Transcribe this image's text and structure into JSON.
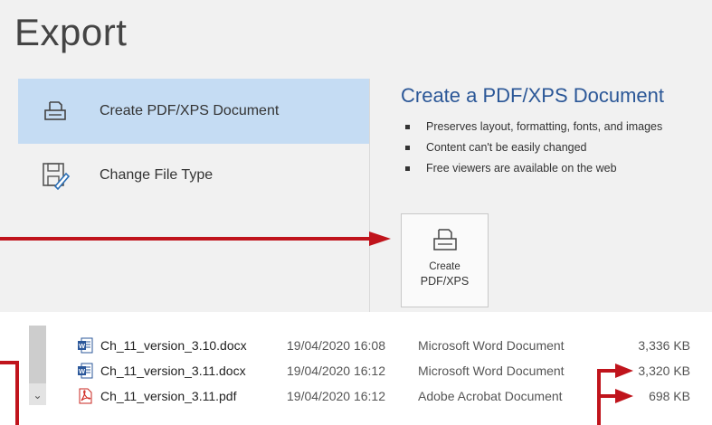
{
  "export_panel": {
    "title": "Export",
    "options": [
      {
        "label": "Create PDF/XPS Document",
        "icon": "printer-document-icon",
        "selected": true
      },
      {
        "label": "Change File Type",
        "icon": "change-file-type-icon",
        "selected": false
      }
    ],
    "pdf_section": {
      "heading": "Create a PDF/XPS Document",
      "bullets": [
        "Preserves layout, formatting, fonts, and images",
        "Content can't be easily changed",
        "Free viewers are available on the web"
      ],
      "button": {
        "line1": "Create",
        "line2": "PDF/XPS",
        "icon": "pdf-create-icon"
      }
    }
  },
  "file_list": {
    "rows": [
      {
        "name": "Ch_11_version_3.10.docx",
        "date": "19/04/2020 16:08",
        "type": "Microsoft Word Document",
        "size": "3,336 KB",
        "icon": "word-doc-icon"
      },
      {
        "name": "Ch_11_version_3.11.docx",
        "date": "19/04/2020 16:12",
        "type": "Microsoft Word Document",
        "size": "3,320 KB",
        "icon": "word-doc-icon"
      },
      {
        "name": "Ch_11_version_3.11.pdf",
        "date": "19/04/2020 16:12",
        "type": "Adobe Acrobat Document",
        "size": "698 KB",
        "icon": "pdf-file-icon"
      }
    ]
  },
  "colors": {
    "accent_blue": "#2b5797",
    "selection": "#c5dcf3",
    "annotation_red": "#c0141c"
  }
}
